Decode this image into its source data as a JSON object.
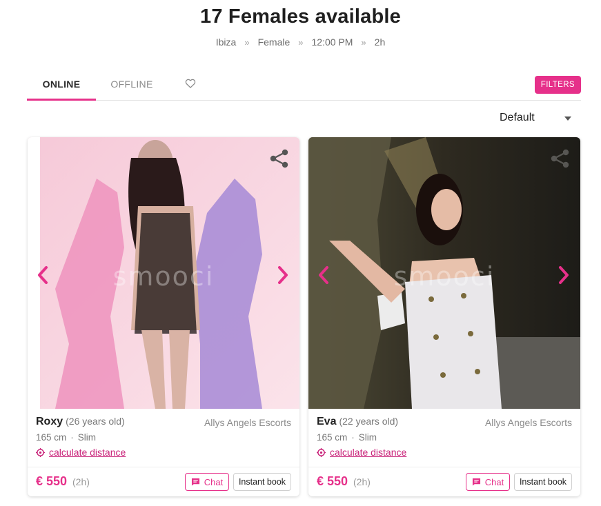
{
  "page": {
    "title": "17 Females available",
    "breadcrumbs": [
      "Ibiza",
      "Female",
      "12:00 PM",
      "2h"
    ],
    "separator": "»"
  },
  "tabs": {
    "online": "ONLINE",
    "offline": "OFFLINE",
    "favorites_icon": "heart-icon",
    "filters": "FILTERS"
  },
  "sort": {
    "selected": "Default"
  },
  "colors": {
    "accent": "#e6308a",
    "link": "#c9247a"
  },
  "cards": [
    {
      "name": "Roxy",
      "age": "(26 years old)",
      "agency": "Allys Angels Escorts",
      "height": "165 cm",
      "build": "Slim",
      "distance_label": "calculate distance",
      "price": "€ 550",
      "duration": "(2h)",
      "chat_label": "Chat",
      "book_label": "Instant book",
      "watermark": "smooci"
    },
    {
      "name": "Eva",
      "age": "(22 years old)",
      "agency": "Allys Angels Escorts",
      "height": "165 cm",
      "build": "Slim",
      "distance_label": "calculate distance",
      "price": "€ 550",
      "duration": "(2h)",
      "chat_label": "Chat",
      "book_label": "Instant book",
      "watermark": "smooci"
    }
  ]
}
